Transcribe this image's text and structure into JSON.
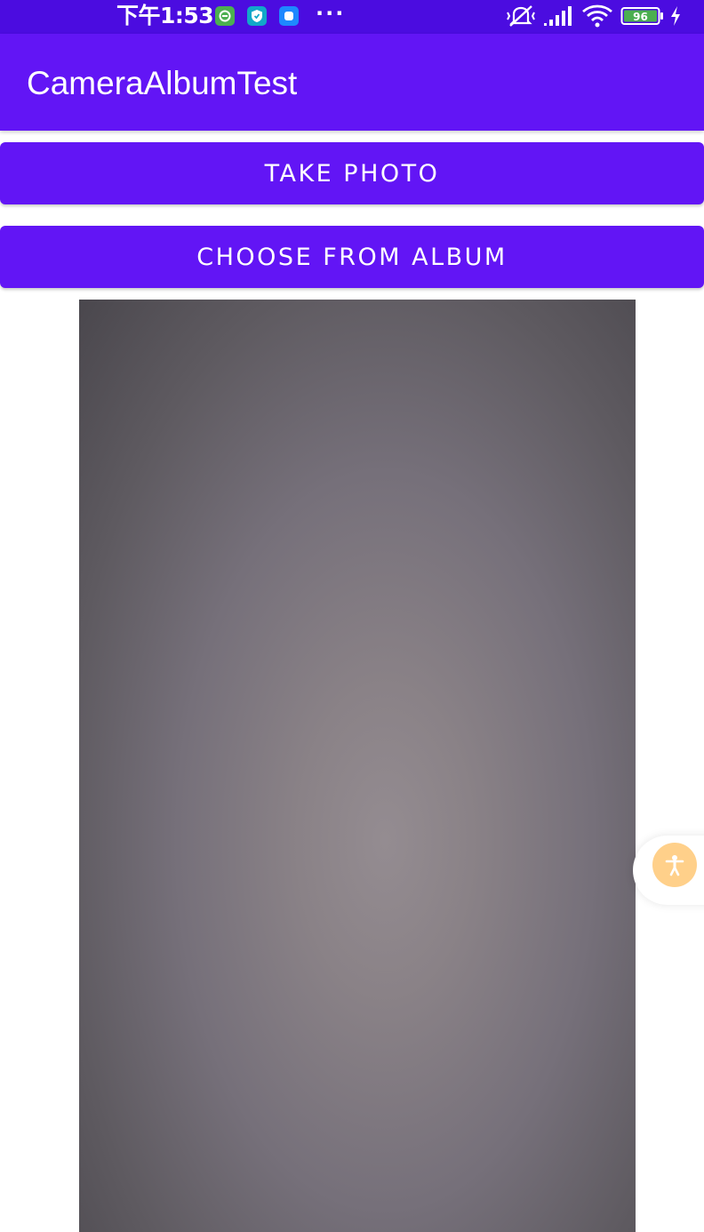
{
  "status_bar": {
    "time": "下午1:53",
    "more": "···",
    "battery": "96",
    "background": "#4b0ce0",
    "notification_icons": [
      "app-notification-icon",
      "shield-icon",
      "chat-icon"
    ],
    "right_icons": [
      "mute-vibrate-icon",
      "signal-icon",
      "wifi-icon",
      "battery-icon",
      "charging-icon"
    ]
  },
  "app_bar": {
    "title": "CameraAlbumTest",
    "background": "#6215f5"
  },
  "buttons": {
    "take_photo": "TAKE PHOTO",
    "choose_album": "CHOOSE FROM ALBUM",
    "color": "#6215f5"
  },
  "floating": {
    "icon": "accessibility-icon",
    "color": "#ffd08a"
  }
}
